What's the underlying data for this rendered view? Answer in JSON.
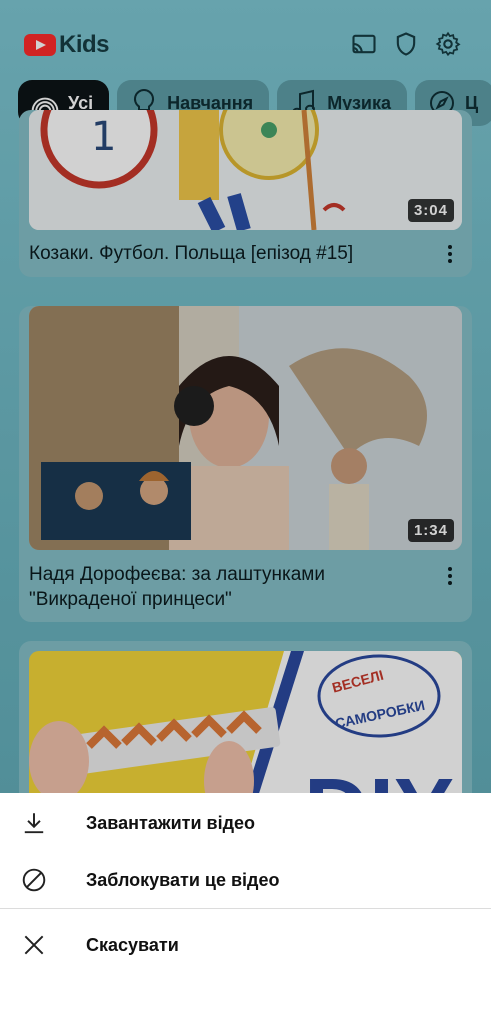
{
  "app": {
    "logo_text": "Kids"
  },
  "header_icons": [
    "cast-icon",
    "shield-icon",
    "gear-icon"
  ],
  "chips": [
    {
      "label": "Усі",
      "icon": "rainbow-icon",
      "active": true
    },
    {
      "label": "Навчання",
      "icon": "lightbulb-icon",
      "active": false
    },
    {
      "label": "Музика",
      "icon": "music-note-icon",
      "active": false
    },
    {
      "label": "Ц",
      "icon": "compass-icon",
      "active": false
    }
  ],
  "videos": [
    {
      "title": "Козаки. Футбол. Польща [епізод #15]",
      "duration": "3:04"
    },
    {
      "title": "Надя Дорофеєва: за лаштунками \"Викраденої принцеси\"",
      "duration": "1:34"
    },
    {
      "thumb_text_top": "ВЕСЕЛІ",
      "thumb_text_bottom": "САМОРОБКИ",
      "thumb_big": "DIY"
    }
  ],
  "sheet": {
    "download_label": "Завантажити відео",
    "block_label": "Заблокувати це відео",
    "cancel_label": "Скасувати"
  }
}
